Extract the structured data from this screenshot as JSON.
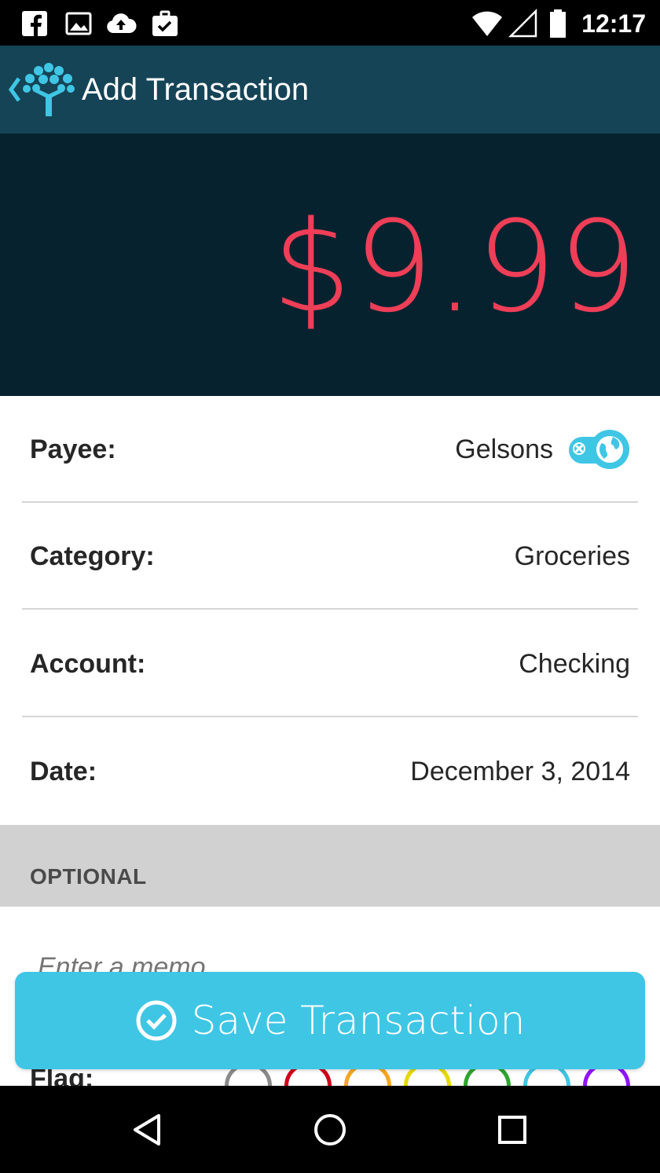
{
  "status_bar": {
    "time": "12:17",
    "icons": [
      "facebook-icon",
      "image-icon",
      "cloud-upload-icon",
      "briefcase-check-icon",
      "wifi-icon",
      "signal-icon",
      "battery-icon"
    ]
  },
  "app_bar": {
    "title": "Add Transaction",
    "icons": [
      "back-chevron-icon",
      "ynab-tree-logo"
    ]
  },
  "amount": {
    "display": "$9.99",
    "color": "#ef3e57"
  },
  "fields": {
    "payee": {
      "label": "Payee:",
      "value": "Gelsons"
    },
    "category": {
      "label": "Category:",
      "value": "Groceries"
    },
    "account": {
      "label": "Account:",
      "value": "Checking"
    },
    "date": {
      "label": "Date:",
      "value": "December 3, 2014"
    }
  },
  "optional": {
    "heading": "OPTIONAL",
    "memo_placeholder": "Enter a memo...",
    "flag_label": "Flag:",
    "flag_colors": [
      "#8a8a8a",
      "#d0021b",
      "#f5a623",
      "#e6d800",
      "#2ea52e",
      "#3fc6e5",
      "#9013fe"
    ]
  },
  "save_button": {
    "label": "Save Transaction"
  },
  "nav_bar": {
    "icons": [
      "back-triangle-icon",
      "home-circle-icon",
      "recents-square-icon"
    ]
  },
  "colors": {
    "accent": "#3fc6e5",
    "app_bar": "#154456",
    "amount_panel": "#06222f"
  }
}
